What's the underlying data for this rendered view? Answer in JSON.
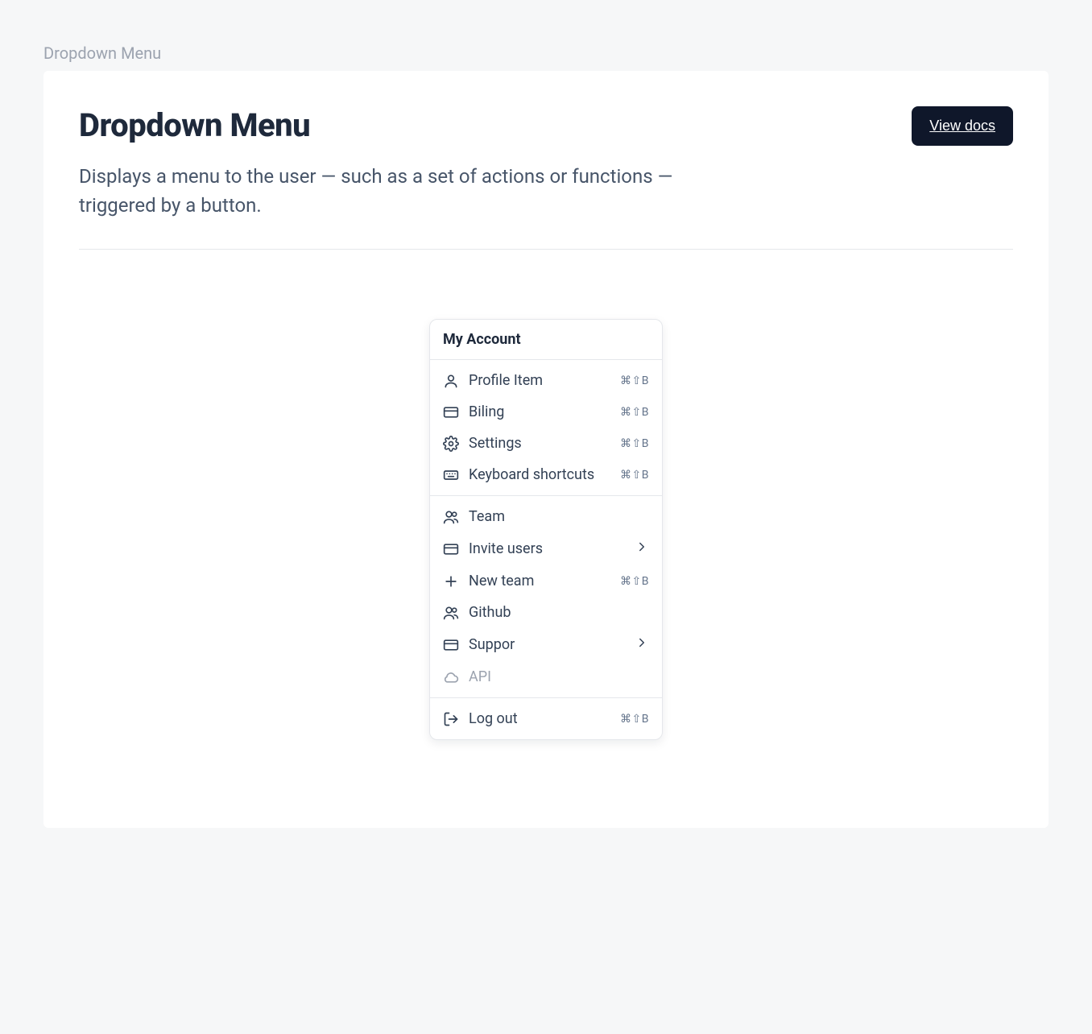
{
  "breadcrumb": "Dropdown Menu",
  "header": {
    "title": "Dropdown Menu",
    "description": "Displays a menu to the user — such as a set of actions or functions — triggered by a button.",
    "view_docs_label": "View docs"
  },
  "dropdown": {
    "title": "My Account",
    "groups": [
      [
        {
          "icon": "user-icon",
          "label": "Profile Item",
          "shortcut": "⌘⇧B"
        },
        {
          "icon": "credit-card-icon",
          "label": "Biling",
          "shortcut": "⌘⇧B"
        },
        {
          "icon": "gear-icon",
          "label": "Settings",
          "shortcut": "⌘⇧B"
        },
        {
          "icon": "keyboard-icon",
          "label": "Keyboard shortcuts",
          "shortcut": "⌘⇧B"
        }
      ],
      [
        {
          "icon": "users-icon",
          "label": "Team"
        },
        {
          "icon": "credit-card-icon",
          "label": "Invite users",
          "submenu": true
        },
        {
          "icon": "plus-icon",
          "label": "New team",
          "shortcut": "⌘⇧B"
        },
        {
          "icon": "users-icon",
          "label": "Github"
        },
        {
          "icon": "credit-card-icon",
          "label": "Suppor",
          "submenu": true
        },
        {
          "icon": "cloud-icon",
          "label": "API",
          "disabled": true
        }
      ],
      [
        {
          "icon": "logout-icon",
          "label": "Log out",
          "shortcut": "⌘⇧B"
        }
      ]
    ]
  }
}
